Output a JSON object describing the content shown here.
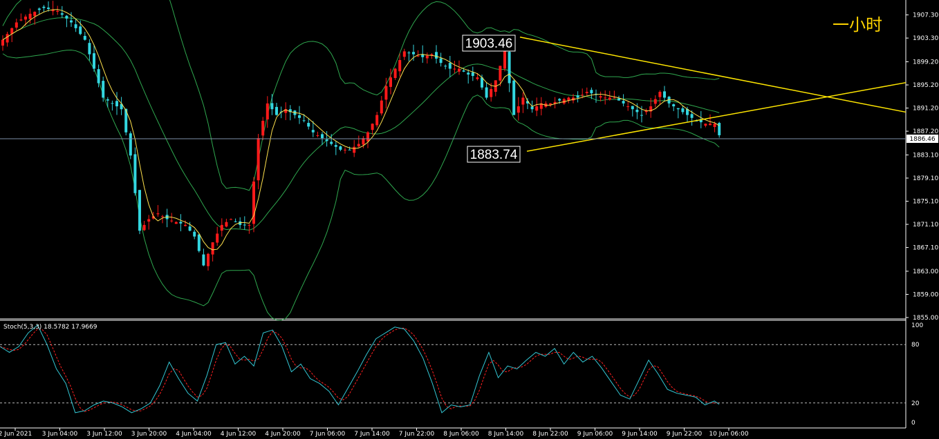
{
  "window": {
    "period_label": "一小时",
    "stoch_label": "Stoch(5,3,3) 18.5782 17.9669",
    "current_price": "1886.46"
  },
  "colors": {
    "background": "#000000",
    "bull_candle": "#ff1a1a",
    "bear_candle": "#33d6e0",
    "bollinger": "#2fa84f",
    "ma": "#ffe14d",
    "trendline": "#ffe600",
    "stoch_main": "#33c7d4",
    "stoch_signal": "#ff2020",
    "axis": "#ffffff",
    "price_line": "#7e8fa8"
  },
  "chart_data": [
    {
      "type": "candlestick",
      "title": "",
      "ylim": [
        1855.0,
        1909.4
      ],
      "y_ticks": [
        "1907.30",
        "1903.30",
        "1899.20",
        "1895.20",
        "1891.20",
        "1887.20",
        "1883.10",
        "1879.10",
        "1875.10",
        "1871.10",
        "1867.10",
        "1863.00",
        "1859.00",
        "1855.00"
      ],
      "x_ticks": [
        "2 Jun 2021",
        "3 Jun 04:00",
        "3 Jun 12:00",
        "3 Jun 20:00",
        "4 Jun 04:00",
        "4 Jun 12:00",
        "4 Jun 20:00",
        "7 Jun 06:00",
        "7 Jun 14:00",
        "7 Jun 22:00",
        "8 Jun 06:00",
        "8 Jun 14:00",
        "8 Jun 22:00",
        "9 Jun 06:00",
        "9 Jun 14:00",
        "9 Jun 22:00",
        "10 Jun 06:00"
      ],
      "price_anchors": [
        [
          0,
          1903
        ],
        [
          3,
          1906
        ],
        [
          6,
          1907.5
        ],
        [
          9,
          1908.5
        ],
        [
          12,
          1908
        ],
        [
          15,
          1906
        ],
        [
          18,
          1903
        ],
        [
          20,
          1898
        ],
        [
          22,
          1893
        ],
        [
          24,
          1892
        ],
        [
          26,
          1891
        ],
        [
          28,
          1883
        ],
        [
          30,
          1870
        ],
        [
          32,
          1872
        ],
        [
          34,
          1873
        ],
        [
          36,
          1872
        ],
        [
          38,
          1871.5
        ],
        [
          40,
          1871
        ],
        [
          42,
          1869
        ],
        [
          44,
          1864
        ],
        [
          46,
          1868
        ],
        [
          48,
          1871
        ],
        [
          50,
          1872
        ],
        [
          52,
          1871
        ],
        [
          54,
          1871
        ],
        [
          56,
          1886
        ],
        [
          58,
          1892
        ],
        [
          60,
          1890
        ],
        [
          62,
          1891
        ],
        [
          64,
          1890
        ],
        [
          66,
          1889
        ],
        [
          68,
          1887
        ],
        [
          70,
          1886
        ],
        [
          72,
          1885
        ],
        [
          74,
          1884
        ],
        [
          76,
          1884
        ],
        [
          78,
          1885
        ],
        [
          80,
          1887
        ],
        [
          82,
          1890
        ],
        [
          84,
          1895
        ],
        [
          86,
          1898
        ],
        [
          88,
          1901
        ],
        [
          90,
          1900.5
        ],
        [
          92,
          1900
        ],
        [
          94,
          1900.5
        ],
        [
          96,
          1899
        ],
        [
          98,
          1898
        ],
        [
          100,
          1898
        ],
        [
          102,
          1897
        ],
        [
          104,
          1896.5
        ],
        [
          106,
          1893
        ],
        [
          108,
          1896
        ],
        [
          110,
          1901
        ],
        [
          112,
          1890
        ],
        [
          114,
          1893
        ],
        [
          116,
          1891
        ],
        [
          118,
          1892
        ],
        [
          120,
          1892
        ],
        [
          122,
          1892.5
        ],
        [
          124,
          1893
        ],
        [
          126,
          1893
        ],
        [
          128,
          1894
        ],
        [
          130,
          1893.5
        ],
        [
          132,
          1893
        ],
        [
          134,
          1893
        ],
        [
          136,
          1892
        ],
        [
          138,
          1891
        ],
        [
          140,
          1890
        ],
        [
          142,
          1891.5
        ],
        [
          144,
          1894
        ],
        [
          146,
          1892
        ],
        [
          148,
          1891
        ],
        [
          150,
          1890
        ],
        [
          152,
          1889
        ],
        [
          154,
          1888.5
        ],
        [
          156,
          1888.5
        ],
        [
          157,
          1886.5
        ]
      ],
      "highlighted_prices": [
        "1903.46",
        "1883.74"
      ],
      "indicators": [
        "Bollinger Bands",
        "Moving Average"
      ]
    },
    {
      "type": "line",
      "title": "Stoch(5,3,3)",
      "series_values": {
        "main": "18.5782",
        "signal": "17.9669"
      },
      "ylim": [
        0,
        100
      ],
      "y_ticks": [
        "100",
        "80",
        "20",
        "0"
      ],
      "levels": [
        80,
        20
      ],
      "main_anchors": [
        [
          0,
          78
        ],
        [
          2,
          72
        ],
        [
          4,
          78
        ],
        [
          6,
          92
        ],
        [
          8,
          100
        ],
        [
          10,
          80
        ],
        [
          12,
          55
        ],
        [
          14,
          40
        ],
        [
          16,
          10
        ],
        [
          18,
          12
        ],
        [
          20,
          18
        ],
        [
          22,
          22
        ],
        [
          24,
          20
        ],
        [
          26,
          16
        ],
        [
          28,
          10
        ],
        [
          30,
          14
        ],
        [
          32,
          20
        ],
        [
          34,
          38
        ],
        [
          36,
          62
        ],
        [
          38,
          45
        ],
        [
          40,
          30
        ],
        [
          42,
          22
        ],
        [
          44,
          48
        ],
        [
          46,
          80
        ],
        [
          48,
          82
        ],
        [
          50,
          60
        ],
        [
          52,
          68
        ],
        [
          54,
          58
        ],
        [
          56,
          92
        ],
        [
          58,
          95
        ],
        [
          60,
          78
        ],
        [
          62,
          52
        ],
        [
          64,
          60
        ],
        [
          66,
          45
        ],
        [
          68,
          40
        ],
        [
          70,
          32
        ],
        [
          72,
          18
        ],
        [
          74,
          35
        ],
        [
          76,
          52
        ],
        [
          78,
          70
        ],
        [
          80,
          86
        ],
        [
          82,
          92
        ],
        [
          84,
          98
        ],
        [
          86,
          96
        ],
        [
          88,
          84
        ],
        [
          90,
          66
        ],
        [
          92,
          40
        ],
        [
          94,
          10
        ],
        [
          96,
          18
        ],
        [
          98,
          16
        ],
        [
          100,
          18
        ],
        [
          102,
          48
        ],
        [
          104,
          72
        ],
        [
          106,
          46
        ],
        [
          108,
          58
        ],
        [
          110,
          55
        ],
        [
          112,
          64
        ],
        [
          114,
          72
        ],
        [
          116,
          68
        ],
        [
          118,
          76
        ],
        [
          120,
          60
        ],
        [
          122,
          72
        ],
        [
          124,
          62
        ],
        [
          126,
          68
        ],
        [
          128,
          56
        ],
        [
          130,
          42
        ],
        [
          132,
          28
        ],
        [
          134,
          24
        ],
        [
          136,
          44
        ],
        [
          138,
          64
        ],
        [
          140,
          50
        ],
        [
          142,
          34
        ],
        [
          144,
          30
        ],
        [
          146,
          28
        ],
        [
          148,
          26
        ],
        [
          150,
          18
        ],
        [
          152,
          22
        ],
        [
          153,
          18.6
        ]
      ]
    }
  ]
}
